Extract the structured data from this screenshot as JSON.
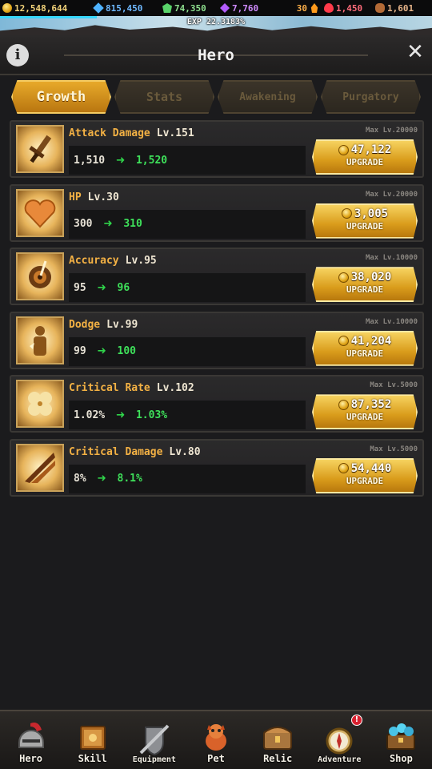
{
  "currencies": [
    {
      "icon": "gold-coin-icon",
      "value": "12,548,644",
      "color": "#f3d37a"
    },
    {
      "icon": "diamond-icon",
      "value": "815,450",
      "color": "#6fb9ff"
    },
    {
      "icon": "green-gem-icon",
      "value": "74,350",
      "color": "#8fe08f"
    },
    {
      "icon": "purple-crystal-icon",
      "value": "7,760",
      "color": "#d08cff"
    },
    {
      "icon": "flame-icon",
      "value": "30",
      "color": "#ffb14a"
    },
    {
      "icon": "ruby-icon",
      "value": "1,450",
      "color": "#ff6b7a"
    },
    {
      "icon": "stone-icon",
      "value": "1,601",
      "color": "#e8b58a"
    }
  ],
  "exp": {
    "text": "EXP 22.3183%",
    "fraction": 0.223183
  },
  "header": {
    "title": "Hero",
    "info_glyph": "i",
    "close_glyph": "✕"
  },
  "tabs": [
    {
      "label": "Growth",
      "active": true
    },
    {
      "label": "Stats",
      "active": false
    },
    {
      "label": "Awakening",
      "active": false
    },
    {
      "label": "Purgatory",
      "active": false
    }
  ],
  "upgrades": [
    {
      "name": "Attack Damage",
      "level": "Lv.151",
      "current": "1,510",
      "next": "1,520",
      "max": "Max Lv.20000",
      "cost": "47,122",
      "button": "UPGRADE",
      "icon": "sword-icon"
    },
    {
      "name": "HP",
      "level": "Lv.30",
      "current": "300",
      "next": "310",
      "max": "Max Lv.20000",
      "cost": "3,005",
      "button": "UPGRADE",
      "icon": "heart-icon"
    },
    {
      "name": "Accuracy",
      "level": "Lv.95",
      "current": "95",
      "next": "96",
      "max": "Max Lv.10000",
      "cost": "38,020",
      "button": "UPGRADE",
      "icon": "target-icon"
    },
    {
      "name": "Dodge",
      "level": "Lv.99",
      "current": "99",
      "next": "100",
      "max": "Max Lv.10000",
      "cost": "41,204",
      "button": "UPGRADE",
      "icon": "silhouette-icon"
    },
    {
      "name": "Critical Rate",
      "level": "Lv.102",
      "current": "1.02%",
      "next": "1.03%",
      "max": "Max Lv.5000",
      "cost": "87,352",
      "button": "UPGRADE",
      "icon": "clover-icon"
    },
    {
      "name": "Critical Damage",
      "level": "Lv.80",
      "current": "8%",
      "next": "8.1%",
      "max": "Max Lv.5000",
      "cost": "54,440",
      "button": "UPGRADE",
      "icon": "slash-icon"
    }
  ],
  "arrow_glyph": "➜",
  "nav": [
    {
      "label": "Hero",
      "icon": "helmet-icon",
      "active": true
    },
    {
      "label": "Skill",
      "icon": "skill-book-icon"
    },
    {
      "label": "Equipment",
      "icon": "equipment-icon"
    },
    {
      "label": "Pet",
      "icon": "pet-icon"
    },
    {
      "label": "Relic",
      "icon": "relic-chest-icon"
    },
    {
      "label": "Adventure",
      "icon": "compass-icon",
      "badge": "!"
    },
    {
      "label": "Shop",
      "icon": "treasure-chest-icon"
    }
  ]
}
